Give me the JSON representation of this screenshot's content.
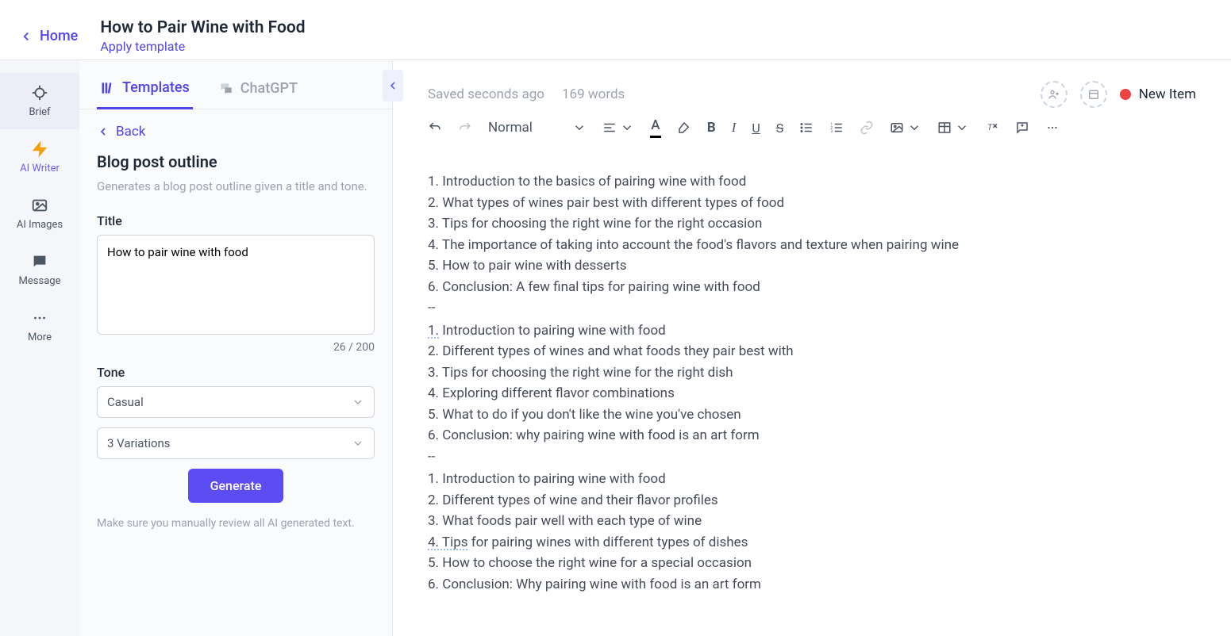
{
  "header": {
    "home": "Home",
    "title": "How to Pair Wine with Food",
    "apply": "Apply template"
  },
  "rail": {
    "brief": "Brief",
    "ai_writer": "AI Writer",
    "ai_images": "AI Images",
    "message": "Message",
    "more": "More"
  },
  "panel": {
    "tabs": {
      "templates": "Templates",
      "chatgpt": "ChatGPT"
    },
    "back": "Back",
    "heading": "Blog post outline",
    "desc": "Generates a blog post outline given a title and tone.",
    "title_label": "Title",
    "title_value": "How to pair wine with food",
    "counter": "26 / 200",
    "tone_label": "Tone",
    "tone_value": "Casual",
    "variations": "3 Variations",
    "generate": "Generate",
    "note": "Make sure you manually review all AI generated text."
  },
  "editor": {
    "saved": "Saved seconds ago",
    "wordcount": "169 words",
    "new_item": "New Item",
    "font_style": "Normal",
    "outlines": [
      [
        "1. Introduction to the basics of pairing wine with food",
        "2. What types of wines pair best with different types of food",
        "3. Tips for choosing the right wine for the right occasion",
        "4. The importance of taking into account the food's flavors and texture when pairing wine",
        "5. How to pair wine with desserts",
        "6. Conclusion: A few final tips for pairing wine with food"
      ],
      [
        "1. Introduction to pairing wine with food",
        "2. Different types of wines and what foods they pair best with",
        "3. Tips for choosing the right wine for the right dish",
        "4. Exploring different flavor combinations",
        "5. What to do if you don't like the wine you've chosen",
        "6. Conclusion: why pairing wine with food is an art form"
      ],
      [
        "1. Introduction to pairing wine with food",
        "2. Different types of wine and their flavor profiles",
        "3. What foods pair well with each type of wine",
        "4. Tips for pairing wines with different types of dishes",
        "5. How to choose the right wine for a special occasion",
        "6. Conclusion: Why pairing wine with food is an art form"
      ]
    ],
    "divider": "--"
  }
}
